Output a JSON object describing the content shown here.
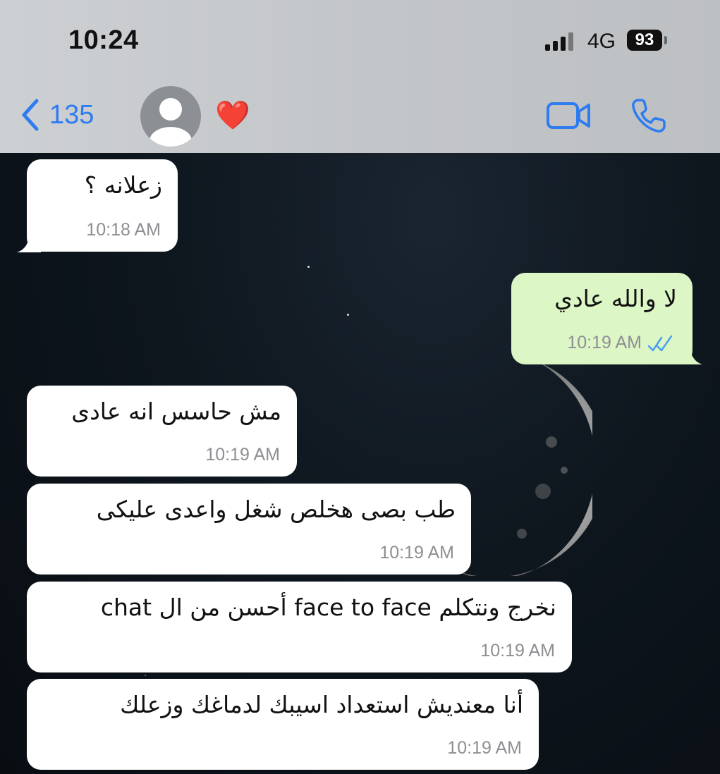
{
  "status_bar": {
    "time": "10:24",
    "network": "4G",
    "battery": "93"
  },
  "header": {
    "back_count": "135",
    "contact_name": "❤️",
    "icons": [
      "chevron-left-icon",
      "avatar-placeholder-icon",
      "video-call-icon",
      "phone-icon"
    ],
    "accent_color": "#2f7bf0"
  },
  "messages": [
    {
      "direction": "incoming",
      "text": "زعلانه ؟",
      "time": "10:18 AM"
    },
    {
      "direction": "outgoing",
      "text": "لا والله عادي",
      "time": "10:19 AM",
      "read": true
    },
    {
      "direction": "incoming",
      "text": "مش حاسس انه عادى",
      "time": "10:19 AM"
    },
    {
      "direction": "incoming",
      "text": "طب بصى هخلص شغل واعدى عليكى",
      "time": "10:19 AM"
    },
    {
      "direction": "incoming",
      "text": "نخرج ونتكلم face to face أحسن من ال chat",
      "time": "10:19 AM"
    },
    {
      "direction": "incoming",
      "text": "أنا معنديش استعداد اسيبك لدماغك وزعلك",
      "time": "10:19 AM"
    }
  ],
  "colors": {
    "incoming_bubble": "#ffffff",
    "outgoing_bubble": "#dcf6c6",
    "read_ticks": "#4a9ff0"
  }
}
